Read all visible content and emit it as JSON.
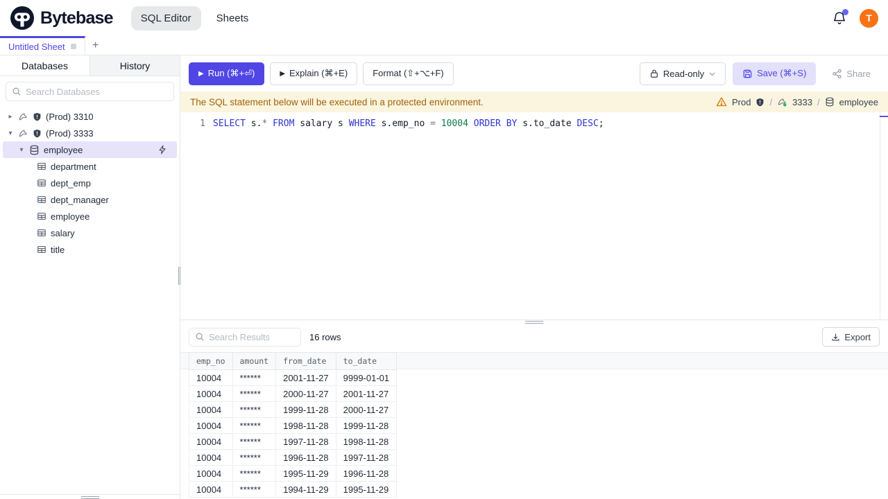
{
  "header": {
    "brand": "Bytebase",
    "nav_sql_editor": "SQL Editor",
    "nav_sheets": "Sheets",
    "avatar_text": "T"
  },
  "tabstrip": {
    "tab_label": "Untitled Sheet",
    "add_label": "+"
  },
  "sidebar": {
    "tab_databases": "Databases",
    "tab_history": "History",
    "search_placeholder": "Search Databases",
    "tree": [
      {
        "type": "instance",
        "label": "(Prod) 3310",
        "expanded": false
      },
      {
        "type": "instance",
        "label": "(Prod) 3333",
        "expanded": true
      },
      {
        "type": "database",
        "label": "employee",
        "selected": true
      },
      {
        "type": "table",
        "label": "department"
      },
      {
        "type": "table",
        "label": "dept_emp"
      },
      {
        "type": "table",
        "label": "dept_manager"
      },
      {
        "type": "table",
        "label": "employee"
      },
      {
        "type": "table",
        "label": "salary"
      },
      {
        "type": "table",
        "label": "title"
      }
    ]
  },
  "toolbar": {
    "run_label": "Run (⌘+⏎)",
    "explain_label": "Explain (⌘+E)",
    "format_label": "Format (⇧+⌥+F)",
    "readonly_label": "Read-only",
    "save_label": "Save (⌘+S)",
    "share_label": "Share"
  },
  "banner": {
    "message": "The SQL statement below will be executed in a protected environment.",
    "environment": "Prod",
    "separator": "/",
    "instance": "3333",
    "database": "employee"
  },
  "editor": {
    "line_number": "1",
    "sql_text": "SELECT s.* FROM salary s WHERE s.emp_no = 10004 ORDER BY s.to_date DESC;",
    "tokens": [
      {
        "t": "SELECT",
        "c": "kw"
      },
      {
        "t": " s.",
        "c": "id"
      },
      {
        "t": "*",
        "c": "op"
      },
      {
        "t": " ",
        "c": "id"
      },
      {
        "t": "FROM",
        "c": "kw"
      },
      {
        "t": " salary s ",
        "c": "id"
      },
      {
        "t": "WHERE",
        "c": "kw"
      },
      {
        "t": " s.emp_no ",
        "c": "id"
      },
      {
        "t": "=",
        "c": "op"
      },
      {
        "t": " ",
        "c": "id"
      },
      {
        "t": "10004",
        "c": "num"
      },
      {
        "t": " ",
        "c": "id"
      },
      {
        "t": "ORDER BY",
        "c": "kw"
      },
      {
        "t": " s.to_date ",
        "c": "id"
      },
      {
        "t": "DESC",
        "c": "kw"
      },
      {
        "t": ";",
        "c": "id"
      }
    ]
  },
  "results": {
    "search_placeholder": "Search Results",
    "row_count_label": "16 rows",
    "export_label": "Export",
    "table": {
      "columns": [
        "emp_no",
        "amount",
        "from_date",
        "to_date"
      ],
      "rows": [
        [
          "10004",
          "******",
          "2001-11-27",
          "9999-01-01"
        ],
        [
          "10004",
          "******",
          "2000-11-27",
          "2001-11-27"
        ],
        [
          "10004",
          "******",
          "1999-11-28",
          "2000-11-27"
        ],
        [
          "10004",
          "******",
          "1998-11-28",
          "1999-11-28"
        ],
        [
          "10004",
          "******",
          "1997-11-28",
          "1998-11-28"
        ],
        [
          "10004",
          "******",
          "1996-11-28",
          "1997-11-28"
        ],
        [
          "10004",
          "******",
          "1995-11-29",
          "1996-11-28"
        ],
        [
          "10004",
          "******",
          "1994-11-29",
          "1995-11-29"
        ]
      ]
    }
  },
  "colors": {
    "accent": "#4f46e5",
    "run_button": "#4f46e5",
    "save_button_bg": "#e2e0fa",
    "warning_bg": "#fbf5e0",
    "warning_text": "#a16207",
    "avatar_bg": "#f97316",
    "sql_keyword": "#2d35cc",
    "sql_number": "#0b7a4b",
    "selected_tree_bg": "#e6e3fa",
    "mysql_status_dot": "#10b981"
  },
  "icons": [
    "bytebase-logo",
    "bell-icon",
    "search-icon",
    "caret-icon",
    "mysql-icon",
    "shield-icon",
    "database-icon",
    "table-icon",
    "bolt-icon",
    "play-icon",
    "lock-icon",
    "chevron-down-icon",
    "save-icon",
    "share-icon",
    "warning-icon",
    "download-icon",
    "plus-icon",
    "drag-handle"
  ]
}
